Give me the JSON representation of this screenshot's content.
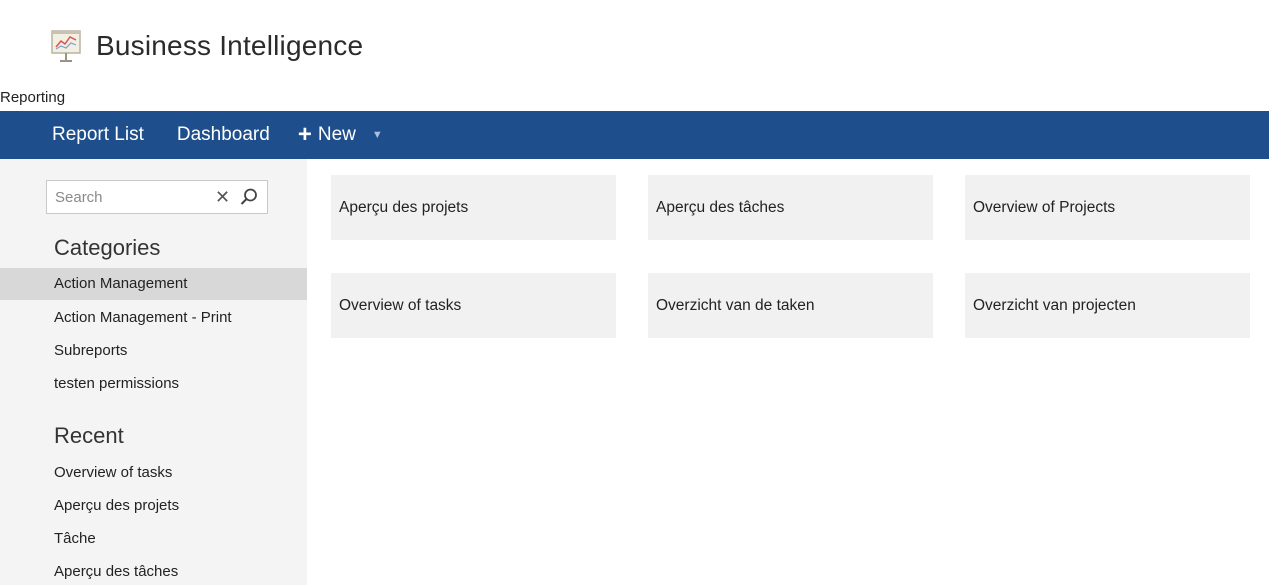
{
  "app": {
    "title": "Business Intelligence",
    "logo_icon": "presentation-chart-icon"
  },
  "breadcrumb": "Reporting",
  "nav": {
    "report_list": "Report List",
    "dashboard": "Dashboard",
    "new_label": "New",
    "new_icon": "plus-icon",
    "dropdown_icon": "caret-down-icon",
    "bar_color": "#1e4f8c"
  },
  "sidebar": {
    "search_placeholder": "Search",
    "clear_icon": "close-icon",
    "search_icon": "search-icon",
    "categories_heading": "Categories",
    "categories": [
      {
        "label": "Action Management",
        "selected": true
      },
      {
        "label": "Action Management - Print",
        "selected": false
      },
      {
        "label": "Subreports",
        "selected": false
      },
      {
        "label": "testen permissions",
        "selected": false
      }
    ],
    "recent_heading": "Recent",
    "recent": [
      {
        "label": "Overview of tasks"
      },
      {
        "label": "Aperçu des projets"
      },
      {
        "label": "Tâche"
      },
      {
        "label": "Aperçu des tâches"
      }
    ]
  },
  "reports": [
    {
      "label": "Aperçu des projets"
    },
    {
      "label": "Aperçu des tâches"
    },
    {
      "label": "Overview of Projects"
    },
    {
      "label": "Overview of tasks"
    },
    {
      "label": "Overzicht van de taken"
    },
    {
      "label": "Overzicht van projecten"
    }
  ]
}
